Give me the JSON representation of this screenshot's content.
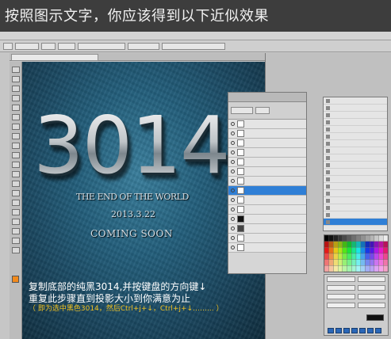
{
  "banner": {
    "title": "按照图示文字，你应该得到以下近似效果"
  },
  "canvas": {
    "big_text": "3014",
    "line1": "THE END OF THE WORLD",
    "line2": "2013.3.22",
    "line3": "COMING SOON"
  },
  "caption": {
    "line1": "复制底部的纯黑3014,并按键盘的方向键↓",
    "line2": "重复此步骤直到投影大小到你满意为止",
    "line3": "（ 即为选中黑色3014，然后Ctrl+j+↓，Ctrl+j+↓……... ）"
  },
  "colors": {
    "foreground_swatch": "#f28a1c",
    "caption_note": "#f0c020",
    "selection": "#2f7fd6"
  }
}
